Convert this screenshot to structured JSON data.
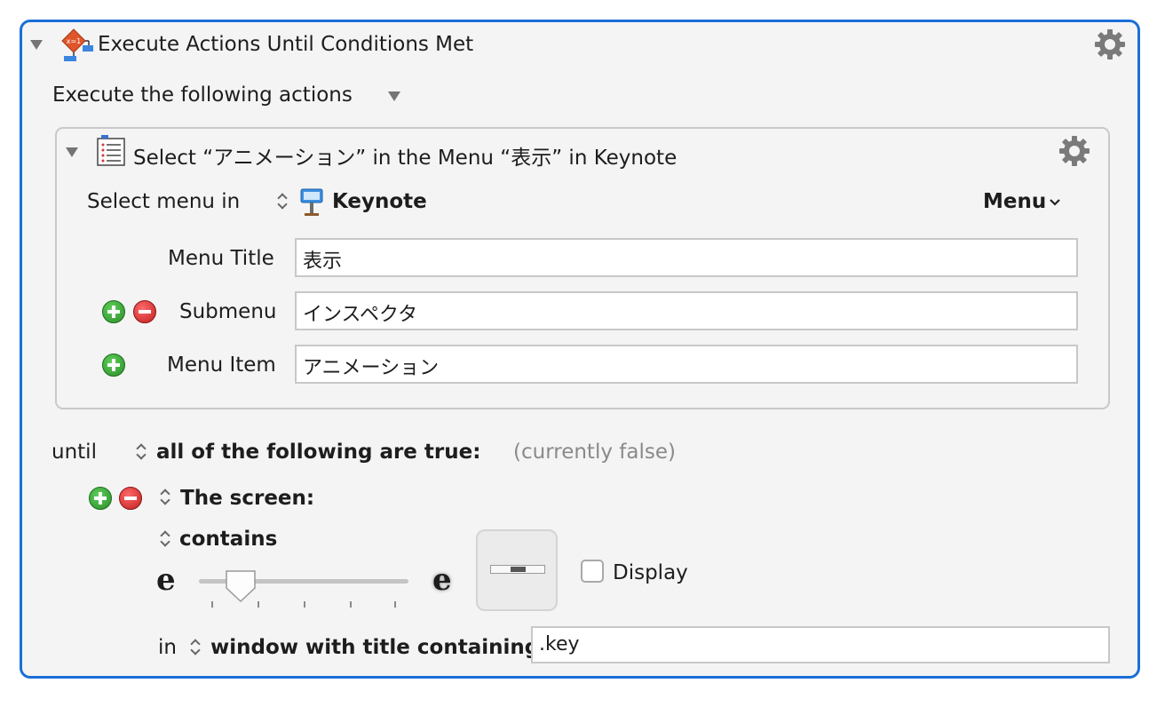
{
  "action": {
    "title": "Execute Actions Until Conditions Met",
    "execute_label": "Execute the following actions"
  },
  "inner_action": {
    "title": "Select “アニメーション” in the Menu “表示” in Keynote",
    "select_menu_label": "Select menu in",
    "app_name": "Keynote",
    "menu_dropdown_label": "Menu",
    "menu_title_label": "Menu Title",
    "menu_title_value": "表示",
    "submenu_label": "Submenu",
    "submenu_value": "インスペクタ",
    "menu_item_label": "Menu Item",
    "menu_item_value": "アニメーション"
  },
  "condition": {
    "until_label": "until",
    "mode": "all of the following are true:",
    "status": "(currently false)",
    "screen_label": "The screen:",
    "contains_label": "contains",
    "fuzz_left_glyph": "e",
    "fuzz_right_glyph": "e",
    "slider_value": 0.2,
    "display_label": "Display",
    "display_checked": false,
    "in_label": "in",
    "scope_label": "window with title containing",
    "scope_value": ".key"
  },
  "colors": {
    "focus_border": "#1a6fd6",
    "plus_green": "#2a8d2a",
    "minus_red": "#c01f1f"
  },
  "icons": [
    "disclosure-triangle-icon",
    "flow-diagram-icon",
    "gear-icon",
    "menu-list-icon",
    "keynote-app-icon",
    "plus-icon",
    "minus-icon",
    "updown-arrows-icon",
    "chevron-down-icon",
    "checkbox-icon"
  ]
}
